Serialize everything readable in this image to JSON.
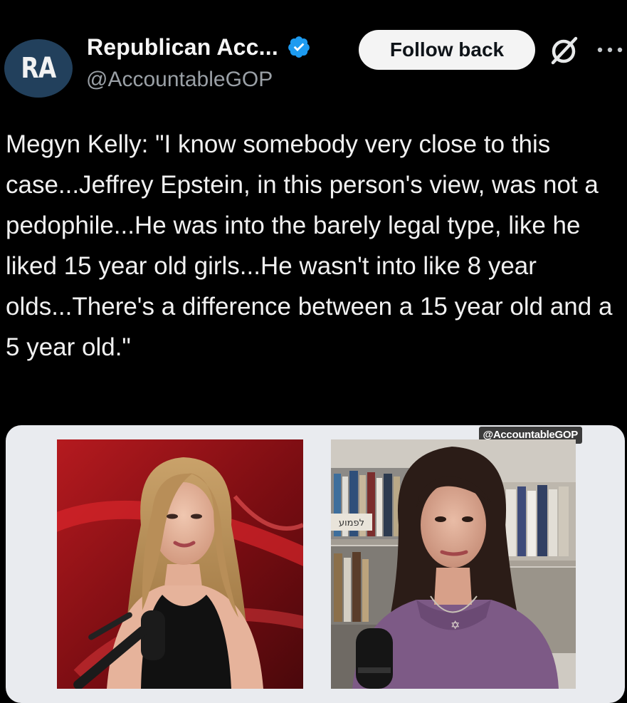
{
  "account": {
    "avatar_initials": "RA",
    "name": "Republican Acc...",
    "handle": "@AccountableGOP",
    "verified": true,
    "verified_color": "#1d9bf0"
  },
  "actions": {
    "follow_label": "Follow back",
    "grok_icon": "grok-icon",
    "more_icon": "more-icon"
  },
  "tweet": {
    "text": "Megyn Kelly: \"I know somebody very close to this case...Jeffrey Epstein, in this person's view, was not a pedophile...He was into the barely legal type, like he liked 15 year old girls...He wasn't into like 8 year olds...There's a difference between a 15 year old and a 5 year old.\""
  },
  "media": {
    "watermark": "@AccountableGOP",
    "book_label": "לפמוע"
  },
  "colors": {
    "background": "#000000",
    "text": "#f1f1f1",
    "secondary_text": "#9aa0a6",
    "button_bg": "#f4f4f4",
    "avatar_bg": "#22405c"
  }
}
